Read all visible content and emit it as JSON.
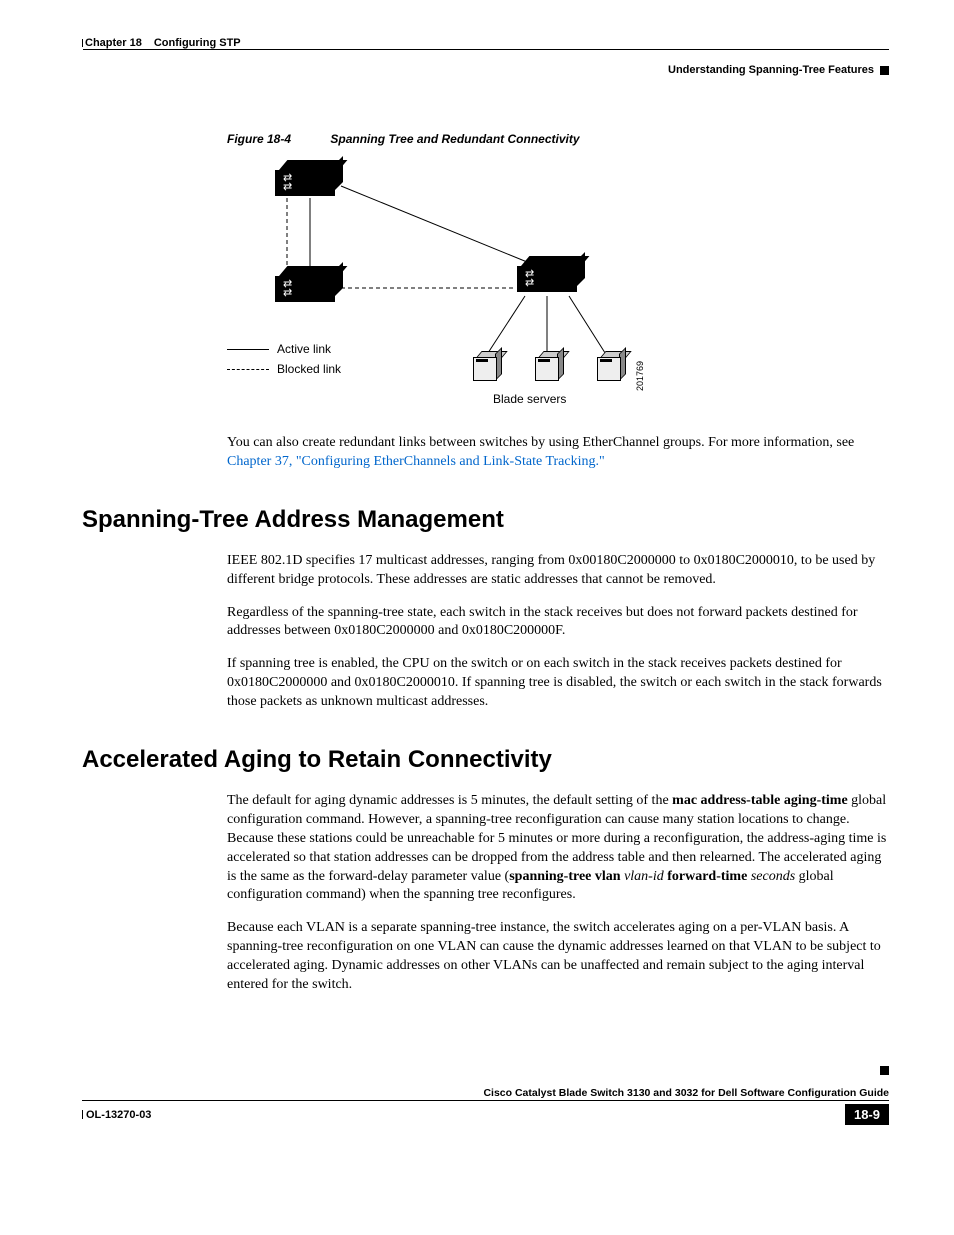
{
  "header": {
    "chapter": "Chapter 18",
    "title": "Configuring STP",
    "section": "Understanding Spanning-Tree Features"
  },
  "figure": {
    "ref": "Figure 18-4",
    "title": "Spanning Tree and Redundant Connectivity",
    "legend_active": "Active link",
    "legend_blocked": "Blocked link",
    "blade_label": "Blade servers",
    "fig_id": "201769"
  },
  "para1_a": "You can also create redundant links between switches by using EtherChannel groups. For more information, see ",
  "para1_link": "Chapter 37, \"Configuring EtherChannels and Link-State Tracking.\"",
  "h2a": "Spanning-Tree Address Management",
  "para2": "IEEE 802.1D specifies 17 multicast addresses, ranging from 0x00180C2000000 to 0x0180C2000010, to be used by different bridge protocols. These addresses are static addresses that cannot be removed.",
  "para3": "Regardless of the spanning-tree state, each switch in the stack receives but does not forward packets destined for addresses between 0x0180C2000000 and 0x0180C200000F.",
  "para4": "If spanning tree is enabled, the CPU on the switch or on each switch in the stack receives packets destined for 0x0180C2000000 and 0x0180C2000010. If spanning tree is disabled, the switch or each switch in the stack forwards those packets as unknown multicast addresses.",
  "h2b": "Accelerated Aging to Retain Connectivity",
  "para5_a": "The default for aging dynamic addresses is 5 minutes, the default setting of the ",
  "para5_b": "mac address-table aging-time",
  "para5_c": " global configuration command. However, a spanning-tree reconfiguration can cause many station locations to change. Because these stations could be unreachable for 5 minutes or more during a reconfiguration, the address-aging time is accelerated so that station addresses can be dropped from the address table and then relearned. The accelerated aging is the same as the forward-delay parameter value (",
  "para5_d": "spanning-tree vlan",
  "para5_e": " vlan-id ",
  "para5_f": "forward-time",
  "para5_g": " seconds",
  "para5_h": " global configuration command) when the spanning tree reconfigures.",
  "para6": "Because each VLAN is a separate spanning-tree instance, the switch accelerates aging on a per-VLAN basis. A spanning-tree reconfiguration on one VLAN can cause the dynamic addresses learned on that VLAN to be subject to accelerated aging. Dynamic addresses on other VLANs can be unaffected and remain subject to the aging interval entered for the switch.",
  "footer": {
    "book": "Cisco Catalyst Blade Switch 3130 and 3032 for Dell Software Configuration Guide",
    "docid": "OL-13270-03",
    "pagenum": "18-9"
  }
}
